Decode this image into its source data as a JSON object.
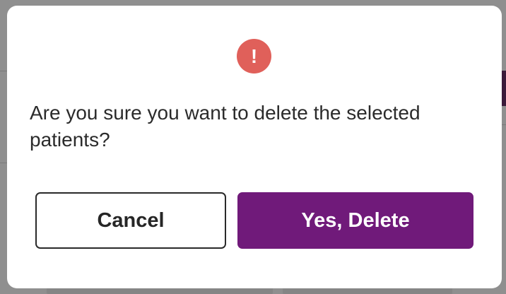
{
  "dialog": {
    "icon": "exclamation-alert-icon",
    "icon_glyph": "!",
    "message": "Are you sure you want to delete the selected patients?",
    "cancel_label": "Cancel",
    "confirm_label": "Yes, Delete"
  },
  "colors": {
    "accent": "#701a7a",
    "alert": "#e0605a",
    "overlay": "#8f8f8f"
  }
}
